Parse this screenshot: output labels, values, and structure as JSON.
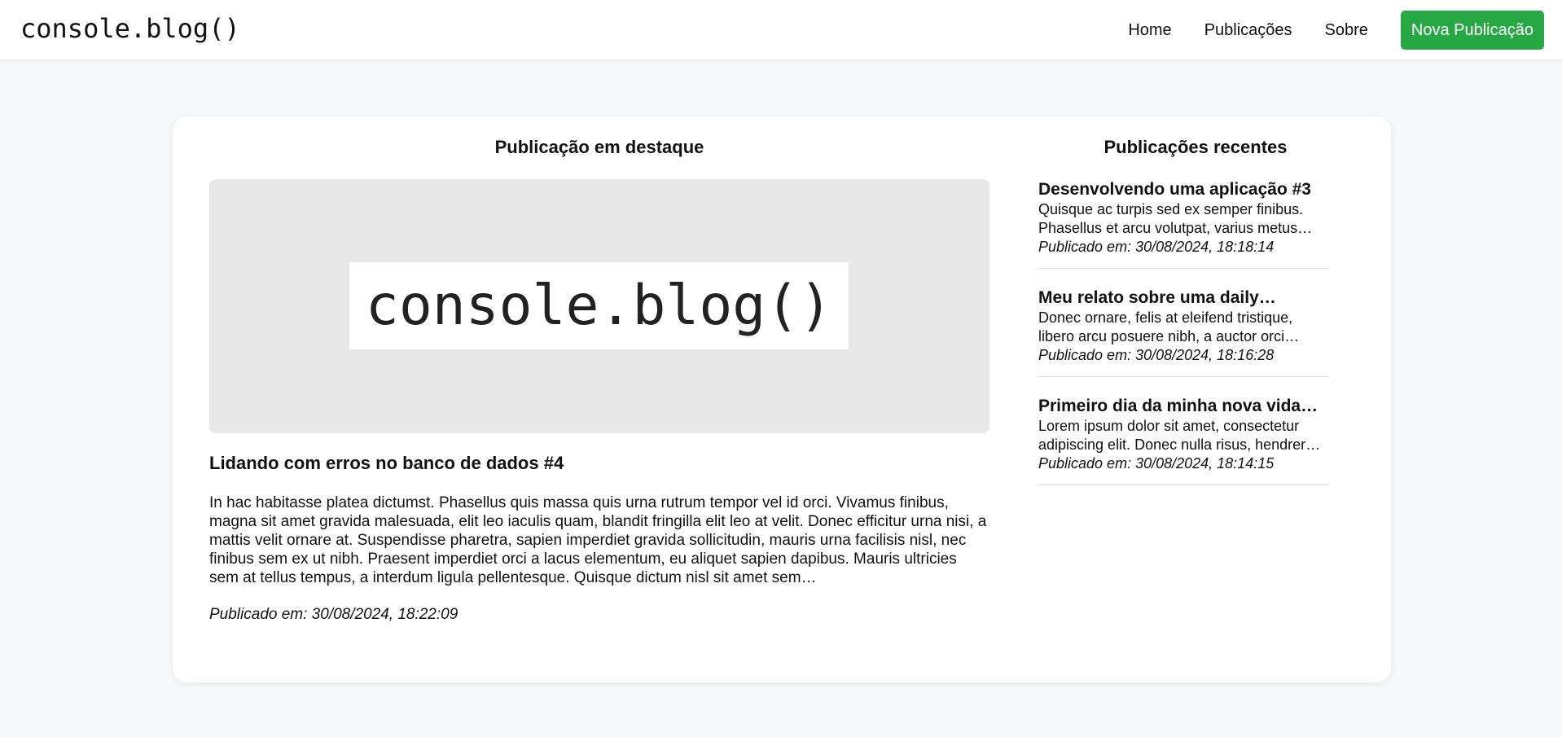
{
  "header": {
    "brand": "console.blog()",
    "nav": {
      "home": "Home",
      "posts": "Publicações",
      "about": "Sobre"
    },
    "new_post_label": "Nova Publicação"
  },
  "colors": {
    "accent": "#28a745",
    "background": "#f8f9fa",
    "card": "#ffffff",
    "hero_bg": "#e8e8e8"
  },
  "featured": {
    "heading": "Publicação em destaque",
    "image_text": "console.blog()",
    "title": "Lidando com erros no banco de dados #4",
    "excerpt": "In hac habitasse platea dictumst. Phasellus quis massa quis urna rutrum tempor vel id orci. Vivamus finibus, magna sit amet gravida malesuada, elit leo iaculis quam, blandit fringilla elit leo at velit. Donec efficitur urna nisi, a mattis velit ornare at. Suspendisse pharetra, sapien imperdiet gravida sollicitudin, mauris urna facilisis nisl, nec finibus sem ex ut nibh. Praesent imperdiet orci a lacus elementum, eu aliquet sapien dapibus. Mauris ultricies sem at tellus tempus, a interdum ligula pellentesque. Quisque dictum nisl sit amet sem…",
    "date": "Publicado em: 30/08/2024, 18:22:09"
  },
  "recent": {
    "heading": "Publicações recentes",
    "items": [
      {
        "title": "Desenvolvendo uma aplicação #3",
        "excerpt_line1": "Quisque ac turpis sed ex semper finibus.",
        "excerpt_line2": "Phasellus et arcu volutpat, varius metus…",
        "date": "Publicado em: 30/08/2024, 18:18:14"
      },
      {
        "title": "Meu relato sobre uma daily…",
        "excerpt_line1": "Donec ornare, felis at eleifend tristique,",
        "excerpt_line2": "libero arcu posuere nibh, a auctor orci…",
        "date": "Publicado em: 30/08/2024, 18:16:28"
      },
      {
        "title": "Primeiro dia da minha nova vida…",
        "excerpt_line1": "Lorem ipsum dolor sit amet, consectetur",
        "excerpt_line2": "adipiscing elit. Donec nulla risus, hendrer…",
        "date": "Publicado em: 30/08/2024, 18:14:15"
      }
    ]
  }
}
